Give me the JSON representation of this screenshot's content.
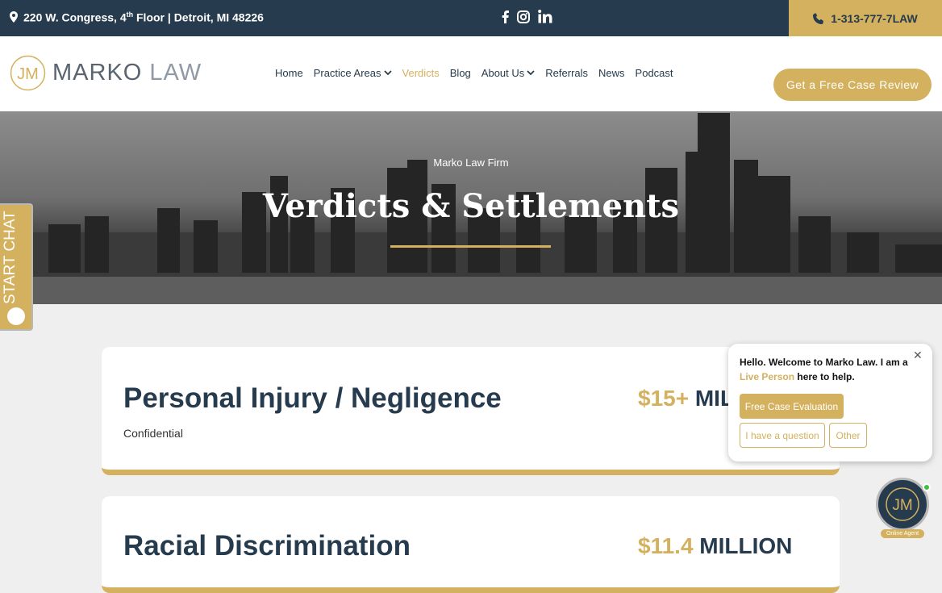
{
  "topbar": {
    "address_pre": "220 W. Congress, 4",
    "address_sup": "th",
    "address_post": " Floor | Detroit, MI 48226",
    "social_icons": [
      "facebook-icon",
      "instagram-icon",
      "linkedin-icon"
    ],
    "phone": "1-313-777-7LAW"
  },
  "header": {
    "logo_monogram": "JM",
    "logo_word1": "MARKO",
    "logo_word2": "LAW",
    "nav": [
      {
        "label": "Home"
      },
      {
        "label": "Practice Areas"
      },
      {
        "label": "Verdicts"
      },
      {
        "label": "Blog"
      },
      {
        "label": "About Us"
      },
      {
        "label": "Referrals"
      },
      {
        "label": "News"
      },
      {
        "label": "Podcast"
      }
    ],
    "cta": "Get a Free Case Review"
  },
  "hero": {
    "kicker": "Marko Law Firm",
    "title": "Verdicts & Settlements"
  },
  "start_chat": "START CHAT",
  "cards": [
    {
      "title": "Personal Injury / Negligence",
      "amount_gold": "$15+",
      "amount_dark": " MILLION",
      "subtitle": "Confidential"
    },
    {
      "title": "Racial Discrimination",
      "amount_gold": "$11.4",
      "amount_dark": " MILLION"
    }
  ],
  "chat_popup": {
    "msg_a": "Hello. Welcome to Marko Law. I am a ",
    "msg_gold": "Live Person",
    "msg_b": " here to help.",
    "btn_eval": "Free Case Evaluation",
    "btn_question": "I have a question",
    "btn_other": "Other"
  },
  "agent": {
    "monogram": "JM",
    "badge": "Online Agent"
  },
  "colors": {
    "navy": "#263b4d",
    "gold": "#d4b15e"
  }
}
